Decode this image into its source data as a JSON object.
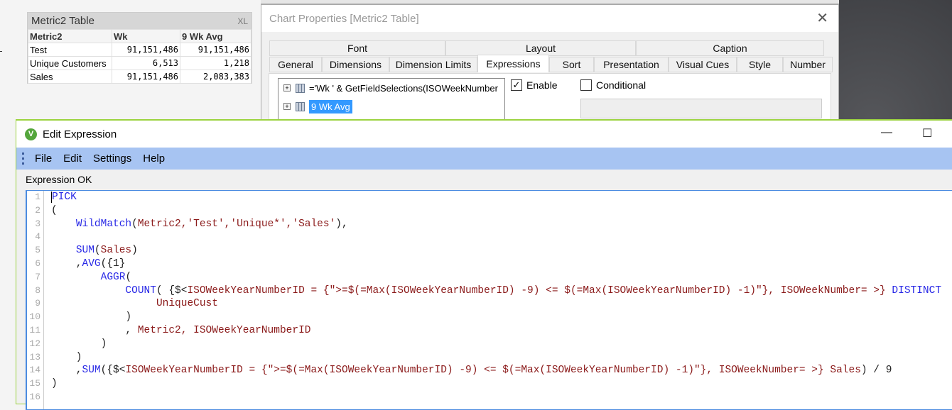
{
  "metric_table": {
    "title": "Metric2 Table",
    "xl_label": "XL",
    "headers": [
      "Metric2",
      "Wk",
      "9 Wk Avg"
    ],
    "rows": [
      [
        "Test",
        "91,151,486",
        "91,151,486"
      ],
      [
        "Unique Customers",
        "6,513",
        "1,218"
      ],
      [
        "Sales",
        "91,151,486",
        "2,083,383"
      ]
    ]
  },
  "chart_properties": {
    "title": "Chart Properties [Metric2 Table]",
    "tabs_top": [
      "Font",
      "Layout",
      "Caption"
    ],
    "tabs_bottom": [
      "General",
      "Dimensions",
      "Dimension Limits",
      "Expressions",
      "Sort",
      "Presentation",
      "Visual Cues",
      "Style",
      "Number"
    ],
    "active_tab": "Expressions",
    "expressions": [
      "='Wk ' & GetFieldSelections(ISOWeekNumber",
      "9 Wk Avg"
    ],
    "enable_label": "Enable",
    "enable_checked": true,
    "conditional_label": "Conditional",
    "conditional_checked": false
  },
  "edit_expression": {
    "title": "Edit Expression",
    "logo": "V",
    "menu": [
      "File",
      "Edit",
      "Settings",
      "Help"
    ],
    "status": "Expression OK",
    "lines": [
      [
        [
          "fn",
          "PICK"
        ]
      ],
      [
        [
          "op",
          "("
        ]
      ],
      [
        [
          "op",
          "    "
        ],
        [
          "fn",
          "WildMatch"
        ],
        [
          "op",
          "("
        ],
        [
          "fld",
          "Metric2,'Test','Unique*','Sales'"
        ],
        [
          "op",
          "),"
        ]
      ],
      [],
      [
        [
          "op",
          "    "
        ],
        [
          "fn",
          "SUM"
        ],
        [
          "op",
          "("
        ],
        [
          "fld",
          "Sales"
        ],
        [
          "op",
          ")"
        ]
      ],
      [
        [
          "op",
          "    ,"
        ],
        [
          "fn",
          "AVG"
        ],
        [
          "op",
          "({1}"
        ]
      ],
      [
        [
          "op",
          "        "
        ],
        [
          "fn",
          "AGGR"
        ],
        [
          "op",
          "("
        ]
      ],
      [
        [
          "op",
          "            "
        ],
        [
          "fn",
          "COUNT"
        ],
        [
          "op",
          "( {$<"
        ],
        [
          "fld",
          "ISOWeekYearNumberID = {\">=$(=Max(ISOWeekYearNumberID) -9) <= $(=Max(ISOWeekYearNumberID) -1)\"}, ISOWeekNumber= >} "
        ],
        [
          "fn",
          "DISTINCT"
        ]
      ],
      [
        [
          "op",
          "                 "
        ],
        [
          "fld",
          "UniqueCust"
        ]
      ],
      [
        [
          "op",
          "            )"
        ]
      ],
      [
        [
          "op",
          "            , "
        ],
        [
          "fld",
          "Metric2, ISOWeekYearNumberID"
        ]
      ],
      [
        [
          "op",
          "        )"
        ]
      ],
      [
        [
          "op",
          "    )"
        ]
      ],
      [
        [
          "op",
          "    ,"
        ],
        [
          "fn",
          "SUM"
        ],
        [
          "op",
          "({$<"
        ],
        [
          "fld",
          "ISOWeekYearNumberID = {\">=$(=Max(ISOWeekYearNumberID) -9) <= $(=Max(ISOWeekYearNumberID) -1)\"}, ISOWeekNumber= >} Sales"
        ],
        [
          "op",
          ") / 9"
        ]
      ],
      [
        [
          "op",
          ")"
        ]
      ],
      []
    ]
  }
}
